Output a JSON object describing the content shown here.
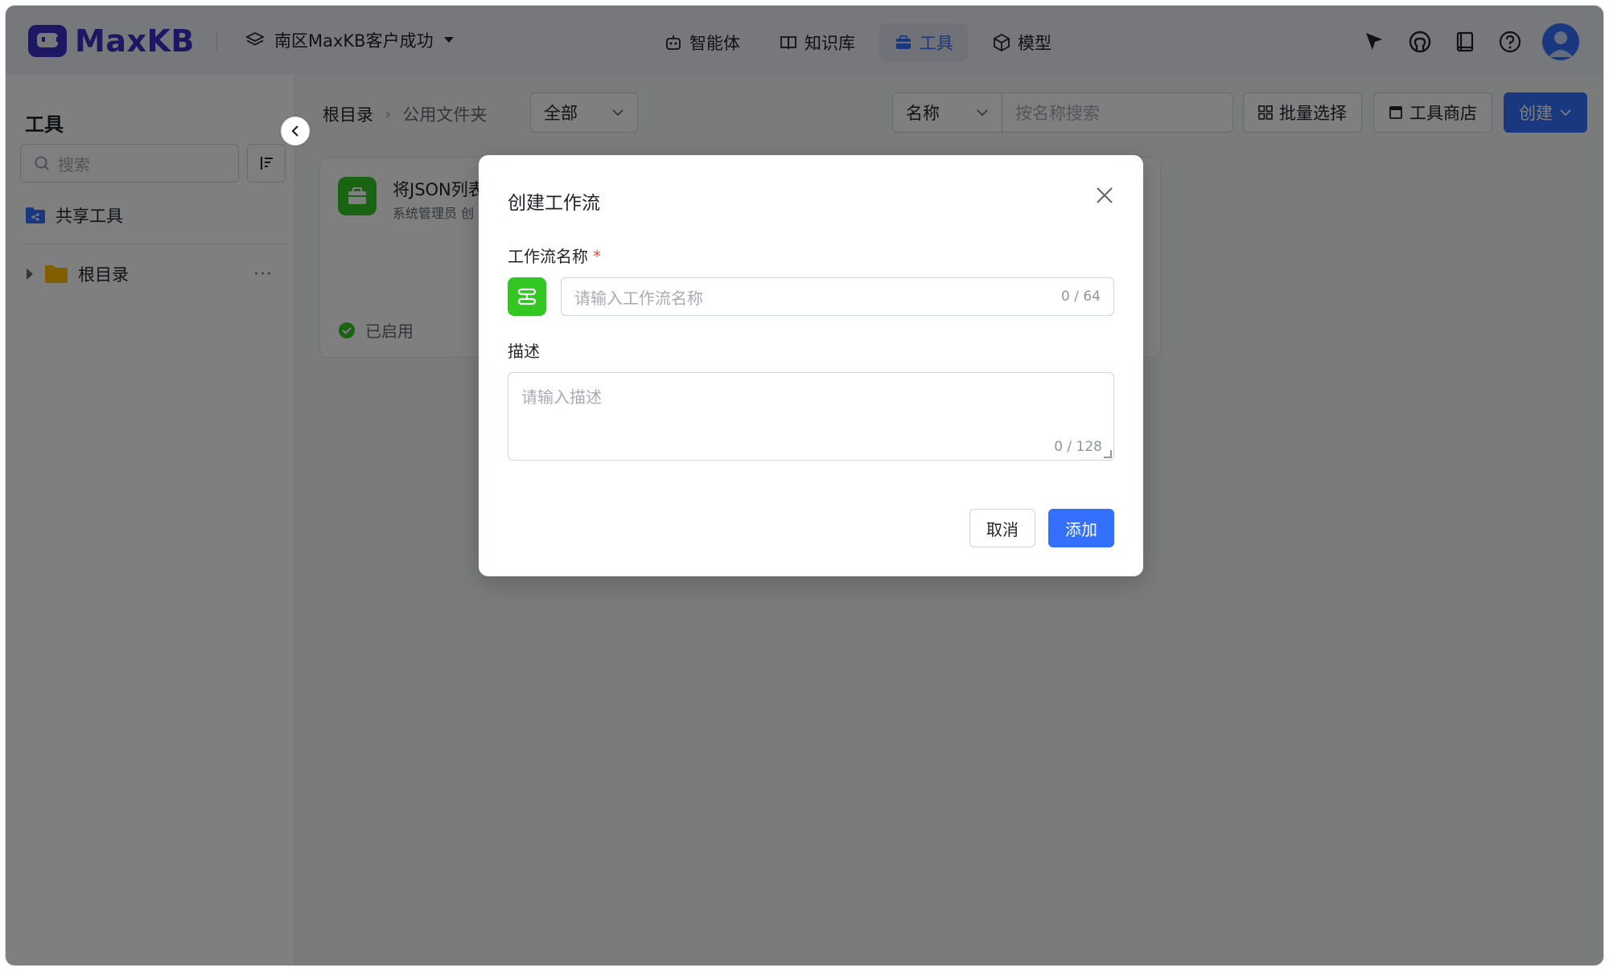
{
  "app": {
    "logo_text": "MaxKB",
    "workspace": "南区MaxKB客户成功"
  },
  "nav": [
    {
      "label": "智能体",
      "icon": "robot-icon"
    },
    {
      "label": "知识库",
      "icon": "book-icon"
    },
    {
      "label": "工具",
      "icon": "toolbox-icon",
      "active": true
    },
    {
      "label": "模型",
      "icon": "cube-icon"
    }
  ],
  "sidebar": {
    "title": "工具",
    "search_placeholder": "搜索",
    "shared_label": "共享工具",
    "root_label": "根目录",
    "more_label": "···"
  },
  "toolbar": {
    "breadcrumb": [
      "根目录",
      "公用文件夹"
    ],
    "breadcrumb_sep": "›",
    "filter_value": "全部",
    "search_field": "名称",
    "search_placeholder": "按名称搜索",
    "batch_select": "批量选择",
    "tool_store": "工具商店",
    "create": "创建"
  },
  "card": {
    "title": "将JSON列表",
    "subtitle": "系统管理员  创",
    "status": "已启用"
  },
  "modal": {
    "title": "创建工作流",
    "name_label": "工作流名称",
    "required_mark": "*",
    "name_placeholder": "请输入工作流名称",
    "name_count": "0 / 64",
    "desc_label": "描述",
    "desc_placeholder": "请输入描述",
    "desc_count": "0 / 128",
    "cancel": "取消",
    "add": "添加"
  },
  "colors": {
    "primary": "#3370ff",
    "brand": "#3b2fc9",
    "success": "#34c724",
    "overlay": "rgba(0,0,0,0.5)"
  }
}
